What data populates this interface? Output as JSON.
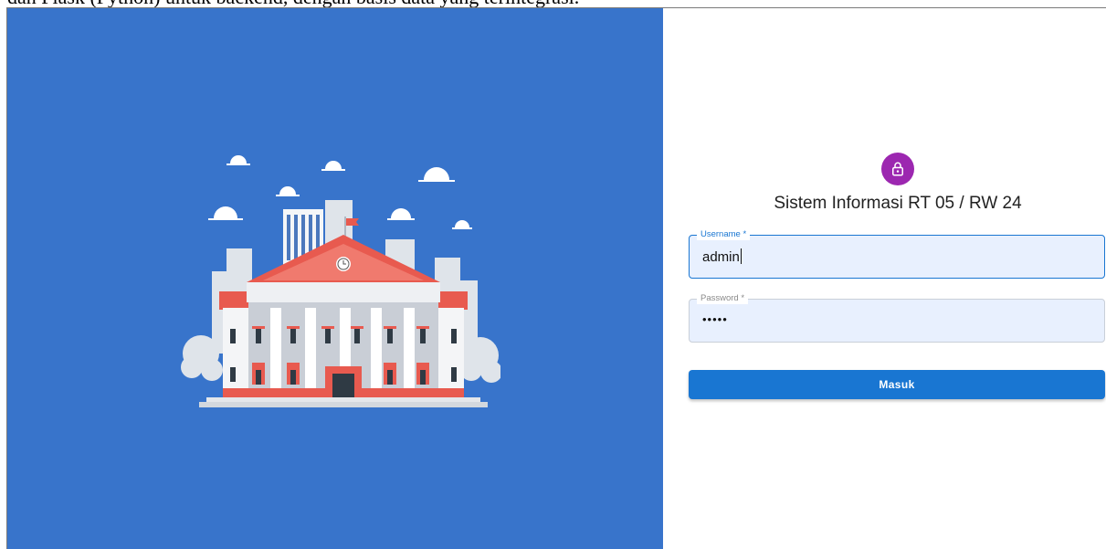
{
  "document": {
    "caption": "dan Flask (Python) untuk backend, dengan basis data yang terintegrasi."
  },
  "login": {
    "icon": "lock-icon",
    "title": "Sistem Informasi RT 05 / RW 24",
    "username": {
      "label": "Username *",
      "value": "admin"
    },
    "password": {
      "label": "Password *",
      "value": "•••••"
    },
    "submit_label": "Masuk"
  },
  "illustration": {
    "icon": "government-building-illustration"
  },
  "colors": {
    "left_panel_bg": "#3874cb",
    "avatar_bg": "#9c27b0",
    "primary": "#1976d2",
    "field_bg": "#e8f0fe"
  }
}
